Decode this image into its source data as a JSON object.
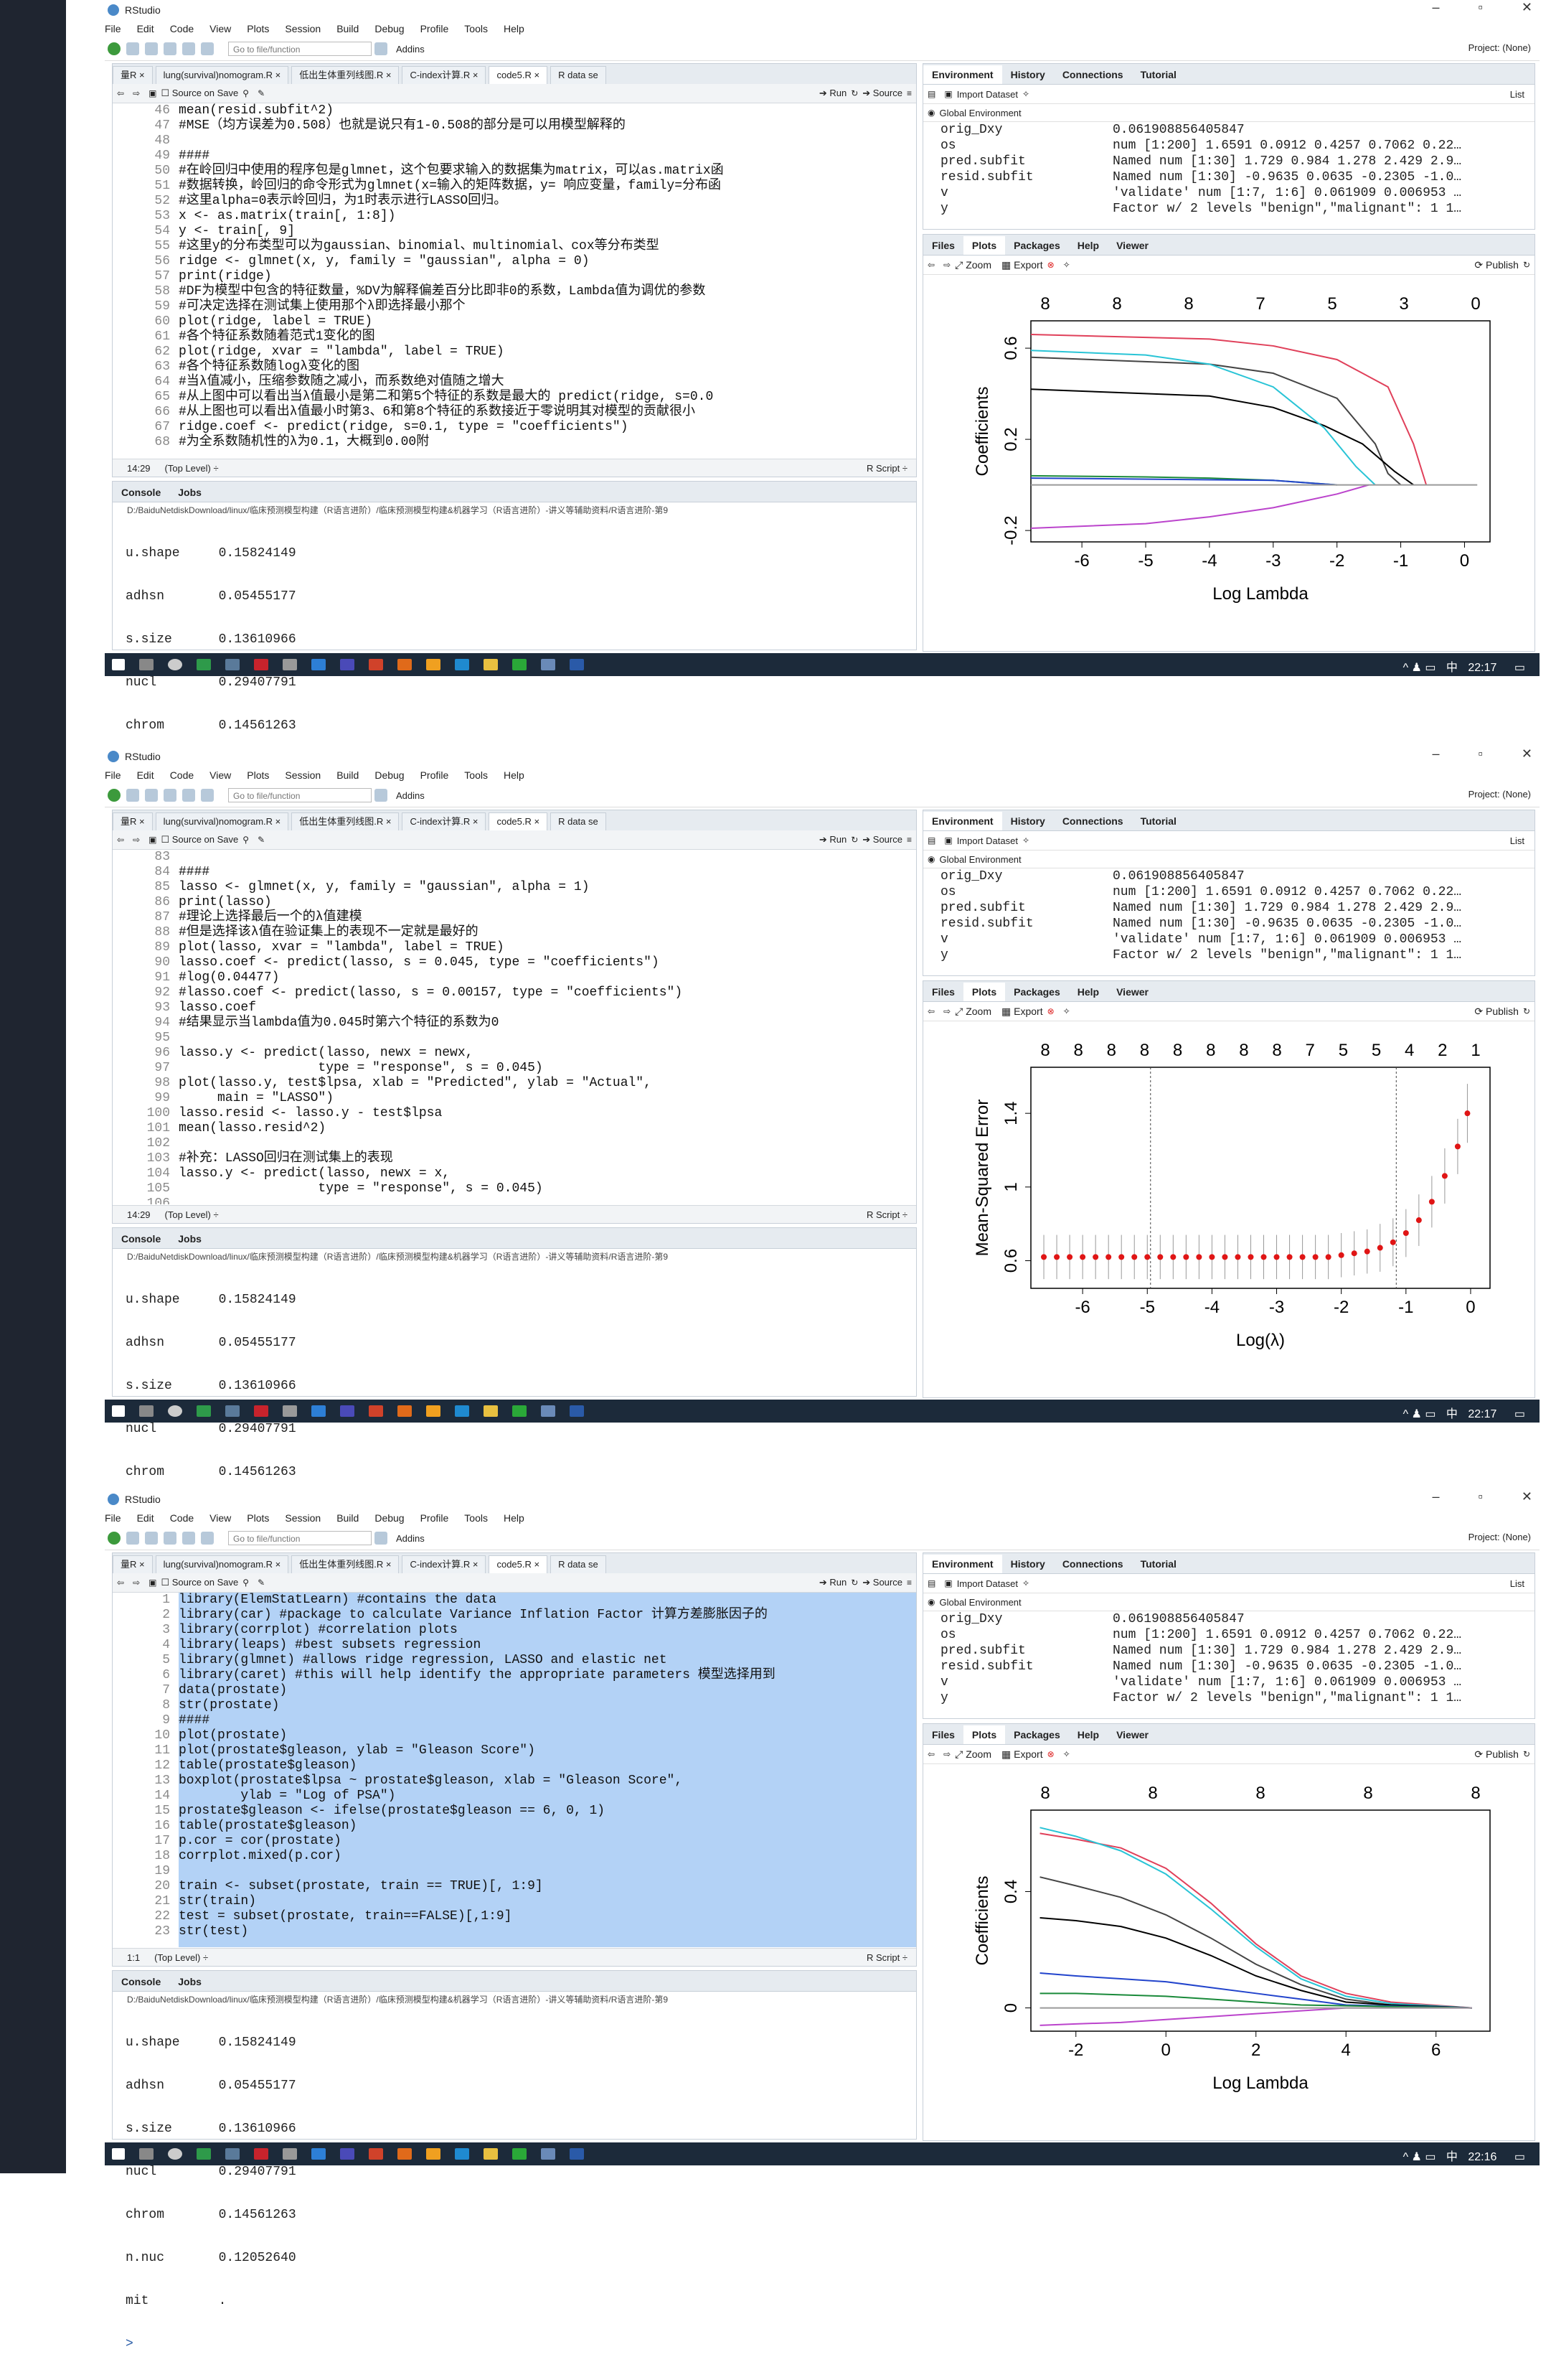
{
  "app": {
    "title": "RStudio",
    "menus": [
      "File",
      "Edit",
      "Code",
      "View",
      "Plots",
      "Session",
      "Build",
      "Debug",
      "Profile",
      "Tools",
      "Help"
    ],
    "goto_placeholder": "Go to file/function",
    "addins": "Addins",
    "project": "Project: (None)",
    "minimize": "–",
    "restore": "▫",
    "close": "✕"
  },
  "editor_tabs": [
    "量R ×",
    "lung(survival)nomogram.R ×",
    "低出生体重列线图.R ×",
    "C-index计算.R ×",
    "code5.R ×",
    "R data se"
  ],
  "editor_tools": {
    "source_on_save": "Source on Save",
    "run": "Run",
    "source": "Source"
  },
  "env": {
    "tabs": [
      "Environment",
      "History",
      "Connections",
      "Tutorial"
    ],
    "import": "Import Dataset",
    "list": "List",
    "global": "Global Environment",
    "rows": [
      [
        "orig_Dxy",
        "0.061908856405847"
      ],
      [
        "os",
        "num [1:200] 1.6591 0.0912 0.4257 0.7062 0.22…"
      ],
      [
        "pred.subfit",
        "Named num [1:30] 1.729 0.984 1.278 2.429 2.9…"
      ],
      [
        "resid.subfit",
        "Named num [1:30] -0.9635 0.0635 -0.2305 -1.0…"
      ],
      [
        "v",
        "'validate' num [1:7, 1:6] 0.061909 0.006953 …"
      ],
      [
        "y",
        "Factor w/ 2 levels \"benign\",\"malignant\": 1 1…"
      ]
    ]
  },
  "files": {
    "tabs": [
      "Files",
      "Plots",
      "Packages",
      "Help",
      "Viewer"
    ],
    "zoom": "Zoom",
    "export": "Export",
    "publish": "Publish"
  },
  "console": {
    "tabs": [
      "Console",
      "Jobs"
    ],
    "path": "D:/BaiduNetdiskDownload/linux/临床预测模型构建（R语言进阶）/临床预测模型构建&机器学习（R语言进阶）-讲义等辅助资料/R语言进阶-第9",
    "lines": [
      "u.shape     0.15824149",
      "adhsn       0.05455177",
      "s.size      0.13610966",
      "nucl        0.29407791",
      "chrom       0.14561263",
      "n.nuc       0.12052640",
      "mit         ."
    ],
    "prompt": ">"
  },
  "taskbar": {
    "time1": "22:17",
    "time2": "22:17",
    "time3": "22:16",
    "ime": "中"
  },
  "screens": [
    {
      "cursor": "14:29",
      "level": "(Top Level) ÷",
      "ftype": "R Script ÷",
      "lines": [
        [
          "46",
          "mean(resid.subfit^2)"
        ],
        [
          "47",
          "#MSE（均方误差为0.508）也就是说只有1-0.508的部分是可以用模型解释的"
        ],
        [
          "48",
          ""
        ],
        [
          "49",
          "####"
        ],
        [
          "50",
          "#在岭回归中使用的程序包是glmnet，这个包要求输入的数据集为matrix，可以as.matrix函"
        ],
        [
          "51",
          "#数据转换，岭回归的命令形式为glmnet(x=输入的矩阵数据，y= 响应变量，family=分布函"
        ],
        [
          "52",
          "#这里alpha=0表示岭回归，为1时表示进行LASSO回归。"
        ],
        [
          "53",
          "x <- as.matrix(train[, 1:8])"
        ],
        [
          "54",
          "y <- train[, 9]"
        ],
        [
          "55",
          "#这里y的分布类型可以为gaussian、binomial、multinomial、cox等分布类型"
        ],
        [
          "56",
          "ridge <- glmnet(x, y, family = \"gaussian\", alpha = 0)"
        ],
        [
          "57",
          "print(ridge)"
        ],
        [
          "58",
          "#DF为模型中包含的特征数量，%DV为解释偏差百分比即非0的系数，Lambda值为调优的参数"
        ],
        [
          "59",
          "#可决定选择在测试集上使用那个λ即选择最小那个"
        ],
        [
          "60",
          "plot(ridge, label = TRUE)"
        ],
        [
          "61",
          "#各个特征系数随着范式1变化的图"
        ],
        [
          "62",
          "plot(ridge, xvar = \"lambda\", label = TRUE)"
        ],
        [
          "63",
          "#各个特征系数随logλ变化的图"
        ],
        [
          "64",
          "#当λ值减小，压缩参数随之减小，而系数绝对值随之增大"
        ],
        [
          "65",
          "#从上图中可以看出当λ值最小是第二和第5个特征的系数是最大的 predict(ridge, s=0.0"
        ],
        [
          "66",
          "#从上图也可以看出λ值最小时第3、6和第8个特征的系数接近于零说明其对模型的贡献很小"
        ],
        [
          "67",
          "ridge.coef <- predict(ridge, s=0.1, type = \"coefficients\")"
        ],
        [
          "68",
          "#为全系数随机性的λ为0.1，大概到0.00附"
        ]
      ]
    },
    {
      "cursor": "14:29",
      "level": "(Top Level) ÷",
      "ftype": "R Script ÷",
      "lines": [
        [
          "83",
          ""
        ],
        [
          "84",
          "####"
        ],
        [
          "85",
          "lasso <- glmnet(x, y, family = \"gaussian\", alpha = 1)"
        ],
        [
          "86",
          "print(lasso)"
        ],
        [
          "87",
          "#理论上选择最后一个的λ值建模"
        ],
        [
          "88",
          "#但是选择该λ值在验证集上的表现不一定就是最好的"
        ],
        [
          "89",
          "plot(lasso, xvar = \"lambda\", label = TRUE)"
        ],
        [
          "90",
          "lasso.coef <- predict(lasso, s = 0.045, type = \"coefficients\")"
        ],
        [
          "91",
          "#log(0.04477)"
        ],
        [
          "92",
          "#lasso.coef <- predict(lasso, s = 0.00157, type = \"coefficients\")"
        ],
        [
          "93",
          "lasso.coef"
        ],
        [
          "94",
          "#结果显示当lambda值为0.045时第六个特征的系数为0"
        ],
        [
          "95",
          ""
        ],
        [
          "96",
          "lasso.y <- predict(lasso, newx = newx,"
        ],
        [
          "97",
          "                  type = \"response\", s = 0.045)"
        ],
        [
          "98",
          "plot(lasso.y, test$lpsa, xlab = \"Predicted\", ylab = \"Actual\","
        ],
        [
          "99",
          "     main = \"LASSO\")"
        ],
        [
          "100",
          "lasso.resid <- lasso.y - test$lpsa"
        ],
        [
          "101",
          "mean(lasso.resid^2)"
        ],
        [
          "102",
          ""
        ],
        [
          "103",
          "#补充：LASSO回归在测试集上的表现"
        ],
        [
          "104",
          "lasso.y <- predict(lasso, newx = x,"
        ],
        [
          "105",
          "                  type = \"response\", s = 0.045)"
        ],
        [
          "106",
          ""
        ]
      ]
    },
    {
      "cursor": "1:1",
      "level": "(Top Level) ÷",
      "ftype": "R Script ÷",
      "lines": [
        [
          "1",
          "library(ElemStatLearn) #contains the data"
        ],
        [
          "2",
          "library(car) #package to calculate Variance Inflation Factor 计算方差膨胀因子的"
        ],
        [
          "3",
          "library(corrplot) #correlation plots"
        ],
        [
          "4",
          "library(leaps) #best subsets regression"
        ],
        [
          "5",
          "library(glmnet) #allows ridge regression, LASSO and elastic net"
        ],
        [
          "6",
          "library(caret) #this will help identify the appropriate parameters 模型选择用到"
        ],
        [
          "7",
          "data(prostate)"
        ],
        [
          "8",
          "str(prostate)"
        ],
        [
          "9",
          "####"
        ],
        [
          "10",
          "plot(prostate)"
        ],
        [
          "11",
          "plot(prostate$gleason, ylab = \"Gleason Score\")"
        ],
        [
          "12",
          "table(prostate$gleason)"
        ],
        [
          "13",
          "boxplot(prostate$lpsa ~ prostate$gleason, xlab = \"Gleason Score\","
        ],
        [
          "14",
          "        ylab = \"Log of PSA\")"
        ],
        [
          "15",
          "prostate$gleason <- ifelse(prostate$gleason == 6, 0, 1)"
        ],
        [
          "16",
          "table(prostate$gleason)"
        ],
        [
          "17",
          "p.cor = cor(prostate)"
        ],
        [
          "18",
          "corrplot.mixed(p.cor)"
        ],
        [
          "19",
          ""
        ],
        [
          "20",
          "train <- subset(prostate, train == TRUE)[, 1:9]"
        ],
        [
          "21",
          "str(train)"
        ],
        [
          "22",
          "test = subset(prostate, train==FALSE)[,1:9]"
        ],
        [
          "23",
          "str(test)"
        ]
      ]
    }
  ],
  "chart_data": [
    {
      "type": "line",
      "title": "",
      "xlabel": "Log Lambda",
      "ylabel": "Coefficients",
      "xlim": [
        -6.8,
        0.4
      ],
      "ylim": [
        -0.25,
        0.72
      ],
      "xticks": [
        -6,
        -5,
        -4,
        -3,
        -2,
        -1,
        0
      ],
      "yticks": [
        -0.2,
        0.2,
        0.6
      ],
      "top_axis_ticks": [
        "8",
        "8",
        "8",
        "7",
        "5",
        "3",
        "0"
      ],
      "series": [
        {
          "color": "#444444",
          "x": [
            -6.8,
            -4,
            -3,
            -2,
            -1.4,
            -1.2,
            -1.0
          ],
          "y": [
            0.56,
            0.53,
            0.49,
            0.38,
            0.18,
            0.05,
            0.0
          ]
        },
        {
          "color": "#000000",
          "x": [
            -6.8,
            -4,
            -3,
            -2.2,
            -1.6,
            -1.1,
            -0.8
          ],
          "y": [
            0.42,
            0.39,
            0.34,
            0.26,
            0.18,
            0.06,
            0.0
          ]
        },
        {
          "color": "#e0405a",
          "x": [
            -6.8,
            -4,
            -3,
            -2,
            -1.2,
            -0.8,
            -0.6
          ],
          "y": [
            0.66,
            0.64,
            0.61,
            0.55,
            0.43,
            0.18,
            0.0
          ]
        },
        {
          "color": "#29c4d6",
          "x": [
            -6.8,
            -5,
            -4,
            -3,
            -2.2,
            -1.7,
            -1.4
          ],
          "y": [
            0.59,
            0.57,
            0.53,
            0.43,
            0.25,
            0.08,
            0.0
          ]
        },
        {
          "color": "#1a8a3a",
          "x": [
            -6.8,
            -5,
            -4,
            -3,
            -2
          ],
          "y": [
            0.04,
            0.035,
            0.03,
            0.02,
            0.0
          ]
        },
        {
          "color": "#2244cc",
          "x": [
            -6.8,
            -3,
            -2.5,
            -2
          ],
          "y": [
            0.03,
            0.02,
            0.01,
            0.0
          ]
        },
        {
          "color": "#bb44cc",
          "x": [
            -6.8,
            -5,
            -4,
            -3,
            -2,
            -1.5
          ],
          "y": [
            -0.19,
            -0.17,
            -0.14,
            -0.1,
            -0.04,
            0.0
          ]
        },
        {
          "color": "#9a9a9a",
          "x": [
            -6.8,
            0.2
          ],
          "y": [
            0.0,
            0.0
          ]
        }
      ]
    },
    {
      "type": "scatter",
      "title": "",
      "xlabel": "Log(λ)",
      "ylabel": "Mean-Squared Error",
      "xlim": [
        -6.8,
        0.3
      ],
      "ylim": [
        0.45,
        1.65
      ],
      "xticks": [
        -6,
        -5,
        -4,
        -3,
        -2,
        -1,
        0
      ],
      "yticks": [
        0.6,
        1.0,
        1.4
      ],
      "top_axis_ticks": [
        "8",
        "8",
        "8",
        "8",
        "8",
        "8",
        "8",
        "8",
        "7",
        "5",
        "5",
        "4",
        "2",
        "1"
      ],
      "vlines": [
        -4.95,
        -1.15
      ],
      "series": [
        {
          "color": "#e01515",
          "x": [
            -6.6,
            -6.4,
            -6.2,
            -6.0,
            -5.8,
            -5.6,
            -5.4,
            -5.2,
            -5.0,
            -4.8,
            -4.6,
            -4.4,
            -4.2,
            -4.0,
            -3.8,
            -3.6,
            -3.4,
            -3.2,
            -3.0,
            -2.8,
            -2.6,
            -2.4,
            -2.2,
            -2.0,
            -1.8,
            -1.6,
            -1.4,
            -1.2,
            -1.0,
            -0.8,
            -0.6,
            -0.4,
            -0.2,
            -0.05
          ],
          "y": [
            0.62,
            0.62,
            0.62,
            0.62,
            0.62,
            0.62,
            0.62,
            0.62,
            0.62,
            0.62,
            0.62,
            0.62,
            0.62,
            0.62,
            0.62,
            0.62,
            0.62,
            0.62,
            0.62,
            0.62,
            0.62,
            0.62,
            0.62,
            0.63,
            0.64,
            0.65,
            0.67,
            0.7,
            0.75,
            0.82,
            0.92,
            1.06,
            1.22,
            1.4
          ],
          "err": [
            0.12,
            0.12,
            0.12,
            0.12,
            0.12,
            0.12,
            0.12,
            0.12,
            0.12,
            0.12,
            0.12,
            0.12,
            0.12,
            0.12,
            0.12,
            0.12,
            0.12,
            0.12,
            0.12,
            0.12,
            0.12,
            0.12,
            0.12,
            0.12,
            0.12,
            0.12,
            0.13,
            0.13,
            0.13,
            0.14,
            0.14,
            0.15,
            0.15,
            0.16
          ]
        }
      ]
    },
    {
      "type": "line",
      "title": "",
      "xlabel": "Log Lambda",
      "ylabel": "Coefficients",
      "xlim": [
        -3,
        7.2
      ],
      "ylim": [
        -0.08,
        0.68
      ],
      "xticks": [
        -2,
        0,
        2,
        4,
        6
      ],
      "yticks": [
        0.0,
        0.4
      ],
      "top_axis_ticks": [
        "8",
        "8",
        "8",
        "8",
        "8"
      ],
      "series": [
        {
          "color": "#e0405a",
          "x": [
            -2.8,
            -2,
            -1,
            0,
            1,
            2,
            3,
            4,
            5,
            6.8
          ],
          "y": [
            0.6,
            0.58,
            0.55,
            0.48,
            0.36,
            0.22,
            0.11,
            0.05,
            0.02,
            0.0
          ]
        },
        {
          "color": "#29c4d6",
          "x": [
            -2.8,
            -2,
            -1,
            0,
            1,
            2,
            3,
            4,
            5,
            6.8
          ],
          "y": [
            0.62,
            0.59,
            0.54,
            0.46,
            0.34,
            0.21,
            0.1,
            0.04,
            0.015,
            0.0
          ]
        },
        {
          "color": "#444444",
          "x": [
            -2.8,
            -2,
            -1,
            0,
            1,
            2,
            3,
            4,
            5,
            6.8
          ],
          "y": [
            0.45,
            0.42,
            0.38,
            0.32,
            0.24,
            0.15,
            0.08,
            0.03,
            0.01,
            0.0
          ]
        },
        {
          "color": "#000000",
          "x": [
            -2.8,
            -2,
            -1,
            0,
            1,
            2,
            3,
            4,
            5,
            6.8
          ],
          "y": [
            0.31,
            0.3,
            0.28,
            0.24,
            0.18,
            0.11,
            0.06,
            0.02,
            0.01,
            0.0
          ]
        },
        {
          "color": "#2244cc",
          "x": [
            -2.8,
            -2,
            -1,
            0,
            1,
            2,
            3,
            4,
            6.8
          ],
          "y": [
            0.12,
            0.11,
            0.1,
            0.09,
            0.07,
            0.05,
            0.03,
            0.01,
            0.0
          ]
        },
        {
          "color": "#1a8a3a",
          "x": [
            -2.8,
            -2,
            -1,
            0,
            1,
            2,
            3,
            6.8
          ],
          "y": [
            0.05,
            0.05,
            0.045,
            0.04,
            0.03,
            0.02,
            0.01,
            0.0
          ]
        },
        {
          "color": "#bb44cc",
          "x": [
            -2.8,
            -2,
            -1,
            0,
            1,
            2,
            3,
            4,
            6.8
          ],
          "y": [
            -0.06,
            -0.055,
            -0.05,
            -0.04,
            -0.03,
            -0.02,
            -0.01,
            0.0,
            0.0
          ]
        },
        {
          "color": "#9a9a9a",
          "x": [
            -2.8,
            6.8
          ],
          "y": [
            0.0,
            0.0
          ]
        }
      ]
    }
  ]
}
